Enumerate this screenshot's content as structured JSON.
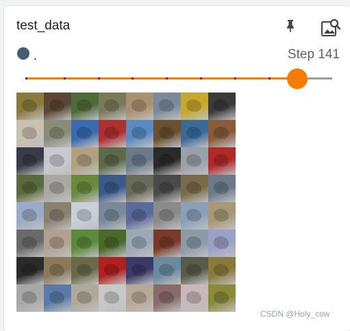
{
  "card": {
    "title": "test_data",
    "pin_icon": "pin-icon",
    "image_search_icon": "image-search-icon"
  },
  "run": {
    "name": ".",
    "color": "#455a75"
  },
  "step": {
    "label": "Step 141"
  },
  "slider": {
    "accent": "#f57c00",
    "rest_color": "#9e9e9e",
    "value_fraction": 0.88
  },
  "image": {
    "description_name": "sample-image-grid",
    "cells": [
      [
        "#8a7a3c",
        "#5a4632",
        "#4f6b3a",
        "#7a7a5a",
        "#a89070",
        "#7a8a9a",
        "#c8a82a",
        "#3a3a3a"
      ],
      [
        "#c8c0b0",
        "#8a8a7a",
        "#3a6ab0",
        "#b03030",
        "#5a8ac0",
        "#6a5030",
        "#3a6a9a",
        "#8a5a3a"
      ],
      [
        "#3a3a4a",
        "#c8c8d0",
        "#b0a080",
        "#5a6a4a",
        "#6a7a8a",
        "#2a2a2a",
        "#9aa0a8",
        "#b02a2a"
      ],
      [
        "#5a6a3a",
        "#a8a8a0",
        "#6a8a3a",
        "#3a5a8a",
        "#6a6a5a",
        "#4a4a4a",
        "#7a6a4a",
        "#6a7a8a"
      ],
      [
        "#9aaac8",
        "#8a8070",
        "#c8d0d8",
        "#7a8a9a",
        "#5a6a9a",
        "#8a8a8a",
        "#8aa0b8",
        "#a89878"
      ],
      [
        "#6a6a6a",
        "#b0a090",
        "#5a8a3a",
        "#4a6a2a",
        "#9aa8b8",
        "#7a3a2a",
        "#8a9aa8",
        "#9aa0c8"
      ],
      [
        "#2a2a2a",
        "#8a7a5a",
        "#6a6a4a",
        "#b02020",
        "#3a3a6a",
        "#6a8aa0",
        "#5a5a4a",
        "#8a7a3a"
      ],
      [
        "#a8a8a8",
        "#5a7aa8",
        "#b0a898",
        "#c8c8c8",
        "#b8a898",
        "#8a6a6a",
        "#c8b8b8",
        "#8a8a3a"
      ]
    ]
  },
  "footer": {
    "watermark": "CSDN @Holy_cow"
  }
}
